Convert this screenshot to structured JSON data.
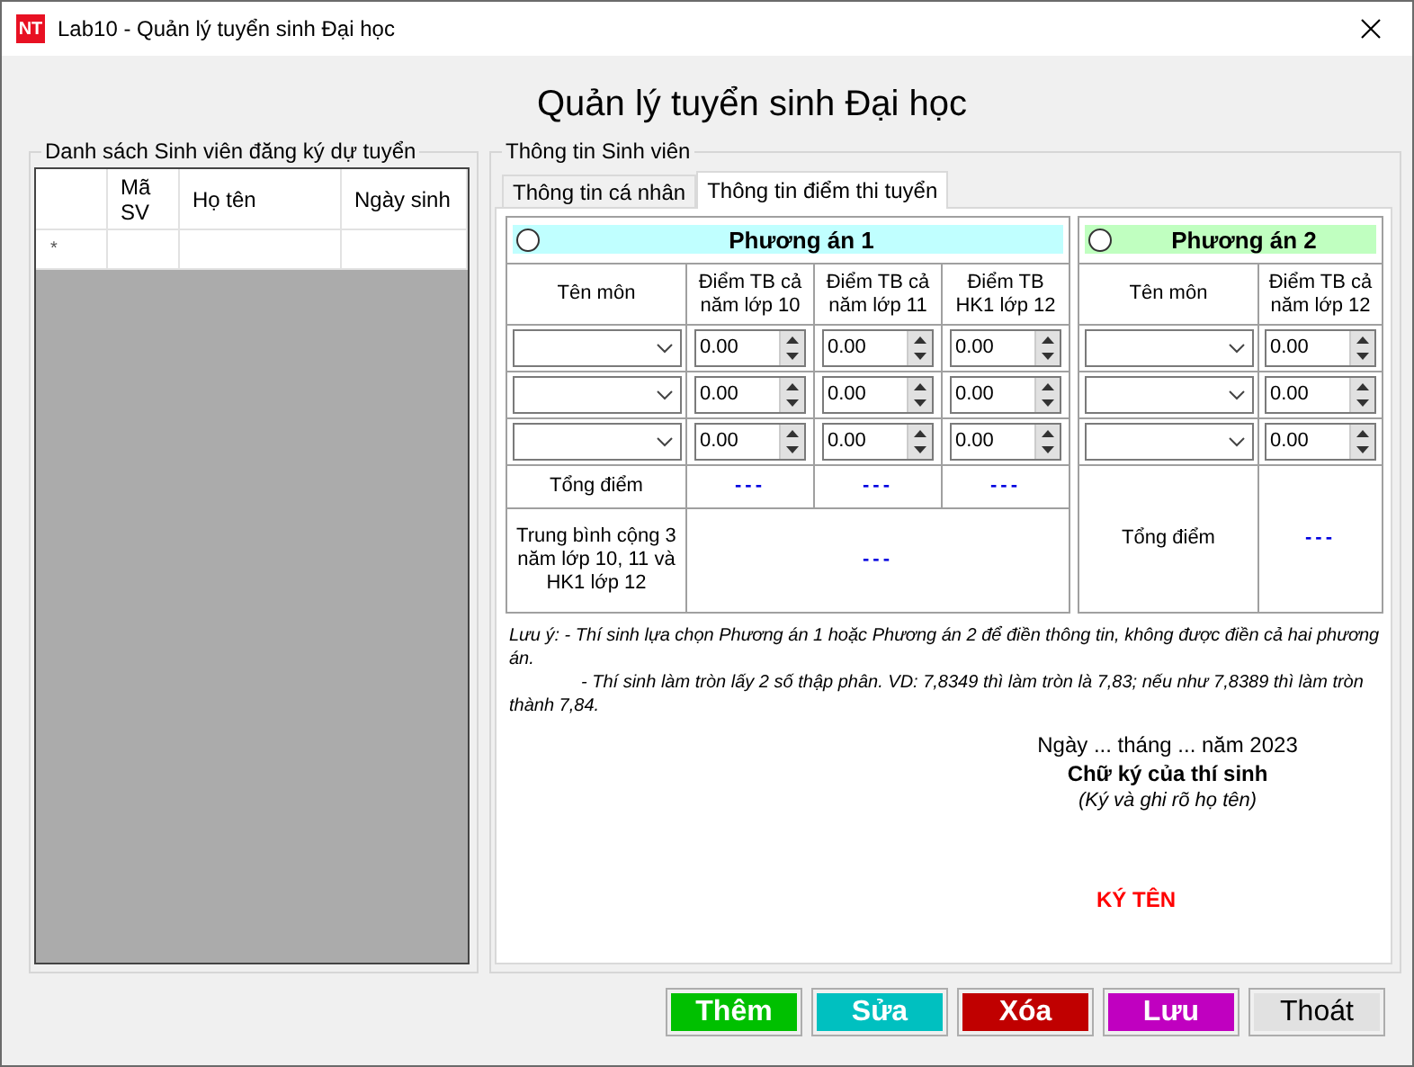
{
  "window": {
    "app_icon": "NT",
    "title": "Lab10 - Quản lý tuyển sinh Đại học"
  },
  "heading": "Quản lý tuyển sinh Đại học",
  "student_list": {
    "title": "Danh sách Sinh viên đăng ký dự tuyển",
    "columns": [
      "Mã SV",
      "Họ tên",
      "Ngày sinh"
    ],
    "new_row_marker": "*"
  },
  "student_info": {
    "title": "Thông tin Sinh viên",
    "tabs": [
      {
        "label": "Thông tin cá nhân",
        "selected": false
      },
      {
        "label": "Thông tin điểm thi tuyển",
        "selected": true
      }
    ],
    "plans": [
      {
        "label": "Phương án 1",
        "selected": false,
        "color": "#c0ffff",
        "subject_header": "Tên môn",
        "score_headers": [
          "Điểm TB cả năm lớp 10",
          "Điểm TB cả năm lớp 11",
          "Điểm TB HK1 lớp 12"
        ],
        "rows": [
          {
            "subject": "",
            "scores": [
              "0.00",
              "0.00",
              "0.00"
            ]
          },
          {
            "subject": "",
            "scores": [
              "0.00",
              "0.00",
              "0.00"
            ]
          },
          {
            "subject": "",
            "scores": [
              "0.00",
              "0.00",
              "0.00"
            ]
          }
        ],
        "summary": [
          {
            "label": "Tổng điểm",
            "values": [
              "---",
              "---",
              "---"
            ]
          },
          {
            "label": "Trung bình cộng 3 năm lớp 10, 11 và HK1 lớp 12",
            "values": [
              "---"
            ]
          }
        ]
      },
      {
        "label": "Phương án 2",
        "selected": false,
        "color": "#c0ffc0",
        "subject_header": "Tên môn",
        "score_headers": [
          "Điểm TB cả năm lớp 12"
        ],
        "rows": [
          {
            "subject": "",
            "scores": [
              "0.00"
            ]
          },
          {
            "subject": "",
            "scores": [
              "0.00"
            ]
          },
          {
            "subject": "",
            "scores": [
              "0.00"
            ]
          }
        ],
        "summary": [
          {
            "label": "Tổng điểm",
            "values": [
              "---"
            ]
          }
        ]
      }
    ],
    "notes": [
      "Lưu ý: - Thí sinh lựa chọn Phương án 1 hoặc Phương án 2 để điền thông tin, không được điền cả hai phương án.",
      "- Thí sinh làm tròn lấy 2 số thập phân. VD: 7,8349 thì làm tròn là 7,83; nếu như 7,8389 thì làm tròn thành 7,84."
    ],
    "signature": {
      "date": "Ngày ... tháng ... năm 2023",
      "title": "Chữ ký của thí sinh",
      "hint": "(Ký và ghi rõ họ tên)",
      "sign_label": "KÝ TÊN"
    }
  },
  "buttons": [
    {
      "label": "Thêm",
      "color": "#00c000"
    },
    {
      "label": "Sửa",
      "color": "#00c0c0"
    },
    {
      "label": "Xóa",
      "color": "#c00000"
    },
    {
      "label": "Lưu",
      "color": "#c000c0"
    },
    {
      "label": "Thoát",
      "color": "#e1e1e1"
    }
  ]
}
